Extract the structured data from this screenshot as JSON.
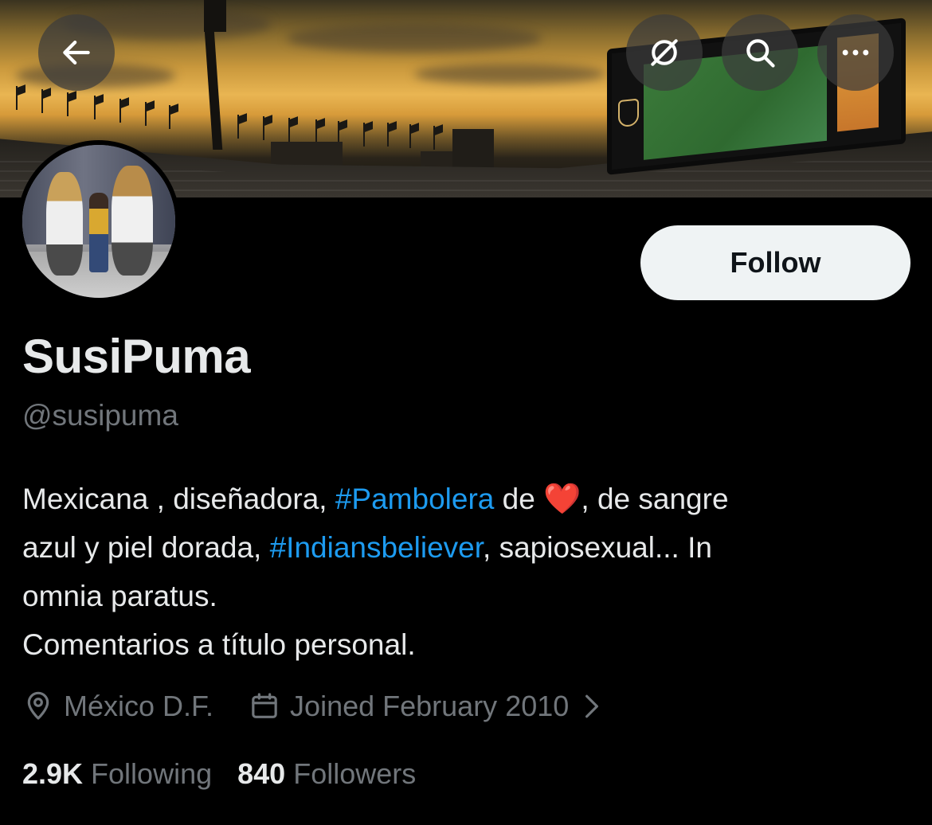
{
  "nav": {
    "back_icon": "arrow-left-icon",
    "grok_icon": "grok-slash-circle-icon",
    "search_icon": "search-icon",
    "more_icon": "more-horizontal-icon"
  },
  "profile": {
    "display_name": "SusiPuma",
    "handle": "@susipuma",
    "follow_label": "Follow",
    "bio": {
      "line1_a": "Mexicana , diseñadora, ",
      "line1_tag": "#Pambolera",
      "line1_b": " de ",
      "line1_heart": "❤️",
      "line1_c": ", de sangre",
      "line2_a": "azul y piel dorada, ",
      "line2_tag": "#Indiansbeliever",
      "line2_b": ", sapiosexual... In",
      "line3": "omnia paratus.",
      "line4": "Comentarios a título personal."
    },
    "location": "México D.F.",
    "joined": "Joined February 2010",
    "following_count": "2.9K",
    "following_label": "Following",
    "followers_count": "840",
    "followers_label": "Followers"
  },
  "colors": {
    "background": "#000000",
    "text_primary": "#e7e9ea",
    "text_secondary": "#71767b",
    "link": "#1d9bf0",
    "follow_bg": "#eff3f4"
  }
}
